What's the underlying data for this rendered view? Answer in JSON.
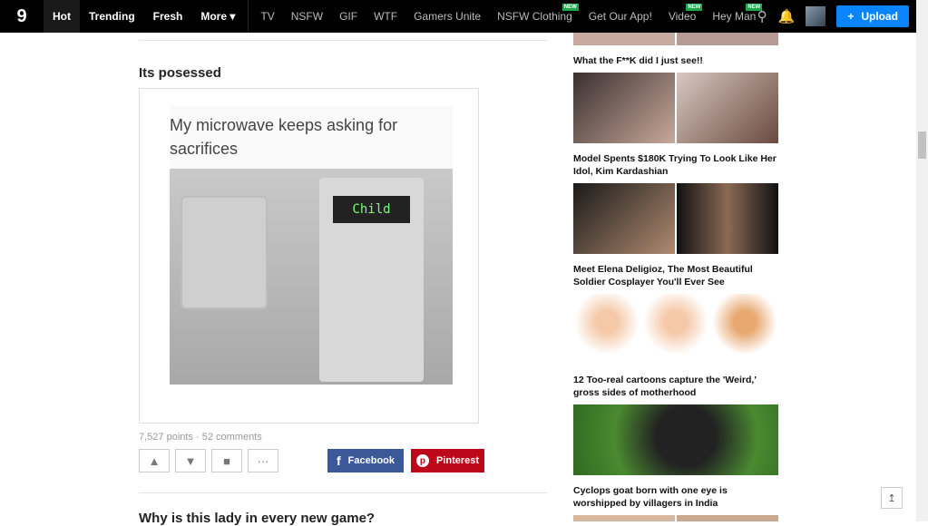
{
  "nav": {
    "logo": "9",
    "items": [
      {
        "label": "Hot",
        "active": true
      },
      {
        "label": "Trending"
      },
      {
        "label": "Fresh"
      },
      {
        "label": "More ▾"
      }
    ],
    "sections": [
      {
        "label": "TV"
      },
      {
        "label": "NSFW"
      },
      {
        "label": "GIF"
      },
      {
        "label": "WTF"
      },
      {
        "label": "Gamers Unite"
      },
      {
        "label": "NSFW Clothing",
        "badge": "NEW"
      },
      {
        "label": "Get Our App!"
      },
      {
        "label": "Video",
        "badge": "NEW"
      },
      {
        "label": "Hey Man",
        "badge": "NEW"
      }
    ],
    "search_icon": "search-icon",
    "bell_icon": "bell-icon",
    "upload_label": "Upload",
    "upload_color": "#0a84ff"
  },
  "post": {
    "title": "Its posessed",
    "meme_text": "My microwave keeps asking for sacrifices",
    "display_text": "Child",
    "meta": "7,527 points · 52 comments",
    "facebook": "Facebook",
    "pinterest": "Pinterest"
  },
  "next_post": {
    "title": "Why is this lady in every new game?"
  },
  "sidebar": [
    {
      "title": "What the F**K did I just see!!"
    },
    {
      "title": "Model Spents $180K Trying To Look Like Her Idol, Kim Kardashian"
    },
    {
      "title": "Meet Elena Deligioz, The Most Beautiful Soldier Cosplayer You'll Ever See"
    },
    {
      "title": "12 Too-real cartoons capture the 'Weird,' gross sides of motherhood"
    },
    {
      "title": "Cyclops goat born with one eye is worshipped by villagers in India"
    }
  ]
}
